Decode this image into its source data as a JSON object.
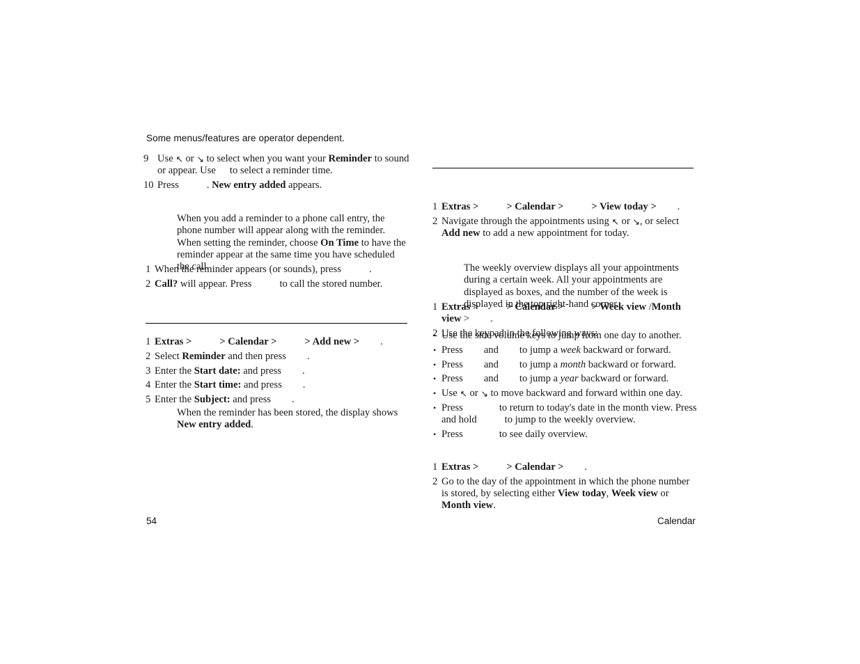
{
  "page": {
    "running_header": "Some menus/features are operator dependent.",
    "footer_page_number": "54",
    "footer_section": "Calendar"
  },
  "icons": {
    "arrow_up_left": "↖",
    "arrow_down_right": "↘",
    "bullet": "•"
  },
  "left_column": {
    "steps_continued": [
      {
        "number": "9",
        "parts": [
          {
            "t": "Use "
          },
          {
            "icon": "arrow_up_left"
          },
          {
            "t": " or "
          },
          {
            "icon": "arrow_down_right"
          },
          {
            "t": " to select when you want your "
          },
          {
            "t": "Reminder",
            "b": true
          },
          {
            "t": " to sound or appear. Use"
          },
          {
            "gap": "w1"
          },
          {
            "t": "to select a reminder time."
          }
        ]
      },
      {
        "number": "10",
        "parts": [
          {
            "t": "Press"
          },
          {
            "gap": "w3"
          },
          {
            "t": ". "
          },
          {
            "t": "New entry added",
            "b": true
          },
          {
            "t": " appears."
          }
        ]
      }
    ],
    "reminder_note": "When you add a reminder to a phone call entry, the phone number will appear along with the reminder. When setting the reminder, choose On Time to have the reminder appear at the same time you have scheduled the call.",
    "reminder_note_parts": [
      {
        "t": "When you add a reminder to a phone call entry, the phone number will appear along with the reminder. When setting the reminder, choose "
      },
      {
        "t": "On Time",
        "b": true
      },
      {
        "t": " to have the reminder appear at the same time you have scheduled the call."
      }
    ],
    "call_steps": [
      {
        "number": "1",
        "parts": [
          {
            "t": "When the reminder appears (or sounds), press"
          },
          {
            "gap": "w3"
          },
          {
            "t": "."
          }
        ]
      },
      {
        "number": "2",
        "parts": [
          {
            "t": "Call?",
            "b": true
          },
          {
            "t": " will appear. Press"
          },
          {
            "gap": "w3"
          },
          {
            "t": "to call the stored number."
          }
        ]
      }
    ],
    "add_reminder_steps": [
      {
        "number": "1",
        "parts": [
          {
            "t": "Extras",
            "b": true
          },
          {
            "t": " >",
            "b": true
          },
          {
            "gap": "w3"
          },
          {
            "t": "> ",
            "b": true
          },
          {
            "t": "Calendar",
            "b": true
          },
          {
            "t": " >",
            "b": true
          },
          {
            "gap": "w3"
          },
          {
            "t": "> ",
            "b": true
          },
          {
            "t": "Add new",
            "b": true
          },
          {
            "t": " >",
            "b": true
          },
          {
            "gap": "w2"
          },
          {
            "t": "."
          }
        ]
      },
      {
        "number": "2",
        "parts": [
          {
            "t": "Select "
          },
          {
            "t": "Reminder",
            "b": true
          },
          {
            "t": " and then press"
          },
          {
            "gap": "w2"
          },
          {
            "t": "."
          }
        ]
      },
      {
        "number": "3",
        "parts": [
          {
            "t": "Enter the "
          },
          {
            "t": "Start date:",
            "b": true
          },
          {
            "t": " and press"
          },
          {
            "gap": "w2"
          },
          {
            "t": "."
          }
        ]
      },
      {
        "number": "4",
        "parts": [
          {
            "t": "Enter the "
          },
          {
            "t": "Start time:",
            "b": true
          },
          {
            "t": " and press"
          },
          {
            "gap": "w2"
          },
          {
            "t": "."
          }
        ]
      },
      {
        "number": "5",
        "parts": [
          {
            "t": "Enter the "
          },
          {
            "t": "Subject:",
            "b": true
          },
          {
            "t": " and press"
          },
          {
            "gap": "w2"
          },
          {
            "t": "."
          }
        ]
      }
    ],
    "stored_note_parts": [
      {
        "t": "When the reminder has been stored, the display shows "
      },
      {
        "t": "New entry added",
        "b": true
      },
      {
        "t": "."
      }
    ]
  },
  "right_column": {
    "view_today_steps": [
      {
        "number": "1",
        "parts": [
          {
            "t": "Extras",
            "b": true
          },
          {
            "t": " >",
            "b": true
          },
          {
            "gap": "w3"
          },
          {
            "t": "> ",
            "b": true
          },
          {
            "t": "Calendar",
            "b": true
          },
          {
            "t": " >",
            "b": true
          },
          {
            "gap": "w3"
          },
          {
            "t": "> ",
            "b": true
          },
          {
            "t": "View today",
            "b": true
          },
          {
            "t": " >",
            "b": true
          },
          {
            "gap": "w2"
          },
          {
            "t": "."
          }
        ]
      },
      {
        "number": "2",
        "parts": [
          {
            "t": "Navigate through the appointments using "
          },
          {
            "icon": "arrow_up_left"
          },
          {
            "t": " or "
          },
          {
            "icon": "arrow_down_right"
          },
          {
            "t": ", or select "
          },
          {
            "t": "Add new",
            "b": true
          },
          {
            "t": " to add a new appointment for today."
          }
        ]
      }
    ],
    "weekly_note": "The weekly overview displays all your appointments during a certain week. All your appointments are displayed as boxes, and the number of the week is displayed in the top right-hand corner.",
    "week_view_steps": [
      {
        "number": "1",
        "parts": [
          {
            "t": "Extras",
            "b": true
          },
          {
            "t": " >",
            "b": true
          },
          {
            "gap": "w3"
          },
          {
            "t": "> ",
            "b": true
          },
          {
            "t": "Calendar",
            "b": true
          },
          {
            "t": " >",
            "b": true
          },
          {
            "gap": "w3"
          },
          {
            "t": "> ",
            "b": true
          },
          {
            "t": "Week view",
            "b": true
          },
          {
            "t": " /"
          },
          {
            "t": "Month view",
            "b": true
          },
          {
            "t": " >"
          },
          {
            "gap": "w2"
          },
          {
            "t": "."
          }
        ]
      },
      {
        "number": "2",
        "parts": [
          {
            "t": "Use the keypad in the following ways:"
          }
        ]
      }
    ],
    "keypad_bullets": [
      {
        "parts": [
          {
            "t": "Use the side volume keys to jump from one day to another."
          }
        ]
      },
      {
        "parts": [
          {
            "t": "Press"
          },
          {
            "gap": "w2"
          },
          {
            "t": "and"
          },
          {
            "gap": "w2"
          },
          {
            "t": "to jump a "
          },
          {
            "t": "week",
            "i": true
          },
          {
            "t": " backward or forward."
          }
        ]
      },
      {
        "parts": [
          {
            "t": "Press"
          },
          {
            "gap": "w2"
          },
          {
            "t": "and"
          },
          {
            "gap": "w2"
          },
          {
            "t": "to jump a "
          },
          {
            "t": "month",
            "i": true
          },
          {
            "t": " backward or forward."
          }
        ]
      },
      {
        "parts": [
          {
            "t": "Press"
          },
          {
            "gap": "w2"
          },
          {
            "t": "and"
          },
          {
            "gap": "w2"
          },
          {
            "t": "to jump a "
          },
          {
            "t": "year",
            "i": true
          },
          {
            "t": " backward or forward."
          }
        ]
      },
      {
        "parts": [
          {
            "t": "Use "
          },
          {
            "icon": "arrow_up_left"
          },
          {
            "t": " or "
          },
          {
            "icon": "arrow_down_right"
          },
          {
            "t": " to move backward and forward within one day."
          }
        ]
      },
      {
        "parts": [
          {
            "t": "Press"
          },
          {
            "gap": "w4"
          },
          {
            "t": "to return to today's date in the month view. Press and hold"
          },
          {
            "gap": "w3"
          },
          {
            "t": "to jump to the weekly overview."
          }
        ]
      },
      {
        "parts": [
          {
            "t": "Press"
          },
          {
            "gap": "w4"
          },
          {
            "t": "to see daily overview."
          }
        ]
      }
    ],
    "phone_steps": [
      {
        "number": "1",
        "parts": [
          {
            "t": "Extras",
            "b": true
          },
          {
            "t": " >",
            "b": true
          },
          {
            "gap": "w3"
          },
          {
            "t": "> ",
            "b": true
          },
          {
            "t": "Calendar",
            "b": true
          },
          {
            "t": " >",
            "b": true
          },
          {
            "gap": "w2"
          },
          {
            "t": "."
          }
        ]
      },
      {
        "number": "2",
        "parts": [
          {
            "t": "Go to the day of the appointment in which the phone number is stored, by selecting either "
          },
          {
            "t": "View today",
            "b": true
          },
          {
            "t": ", "
          },
          {
            "t": "Week view",
            "b": true
          },
          {
            "t": " or "
          },
          {
            "t": "Month view",
            "b": true
          },
          {
            "t": "."
          }
        ]
      }
    ]
  }
}
